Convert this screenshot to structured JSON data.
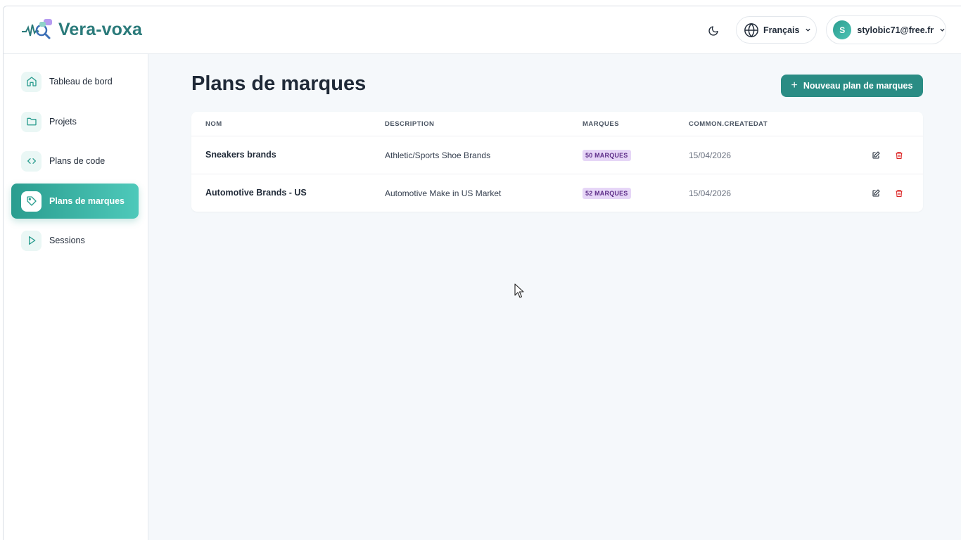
{
  "app": {
    "name": "Vera-voxa"
  },
  "header": {
    "language": "Français",
    "user_initial": "S",
    "user_email": "stylobic71@free.fr"
  },
  "sidebar": {
    "items": [
      {
        "label": "Tableau de bord",
        "icon": "home-icon",
        "active": false
      },
      {
        "label": "Projets",
        "icon": "folder-icon",
        "active": false
      },
      {
        "label": "Plans de code",
        "icon": "code-icon",
        "active": false
      },
      {
        "label": "Plans de marques",
        "icon": "tag-icon",
        "active": true
      },
      {
        "label": "Sessions",
        "icon": "play-icon",
        "active": false
      }
    ]
  },
  "page": {
    "title": "Plans de marques",
    "new_button": "Nouveau plan de marques"
  },
  "table": {
    "columns": [
      "NOM",
      "DESCRIPTION",
      "MARQUES",
      "COMMON.CREATEDAT"
    ],
    "rows": [
      {
        "name": "Sneakers brands",
        "description": "Athletic/Sports Shoe Brands",
        "brands": "50 MARQUES",
        "created": "15/04/2026"
      },
      {
        "name": "Automotive Brands - US",
        "description": "Automotive Make in US Market",
        "brands": "52 MARQUES",
        "created": "15/04/2026"
      }
    ]
  },
  "colors": {
    "accent": "#2a9d8f",
    "brand_text": "#2a7a7a",
    "badge_bg": "#e6d6f7",
    "badge_text": "#5b2a86",
    "delete": "#dc2626"
  }
}
